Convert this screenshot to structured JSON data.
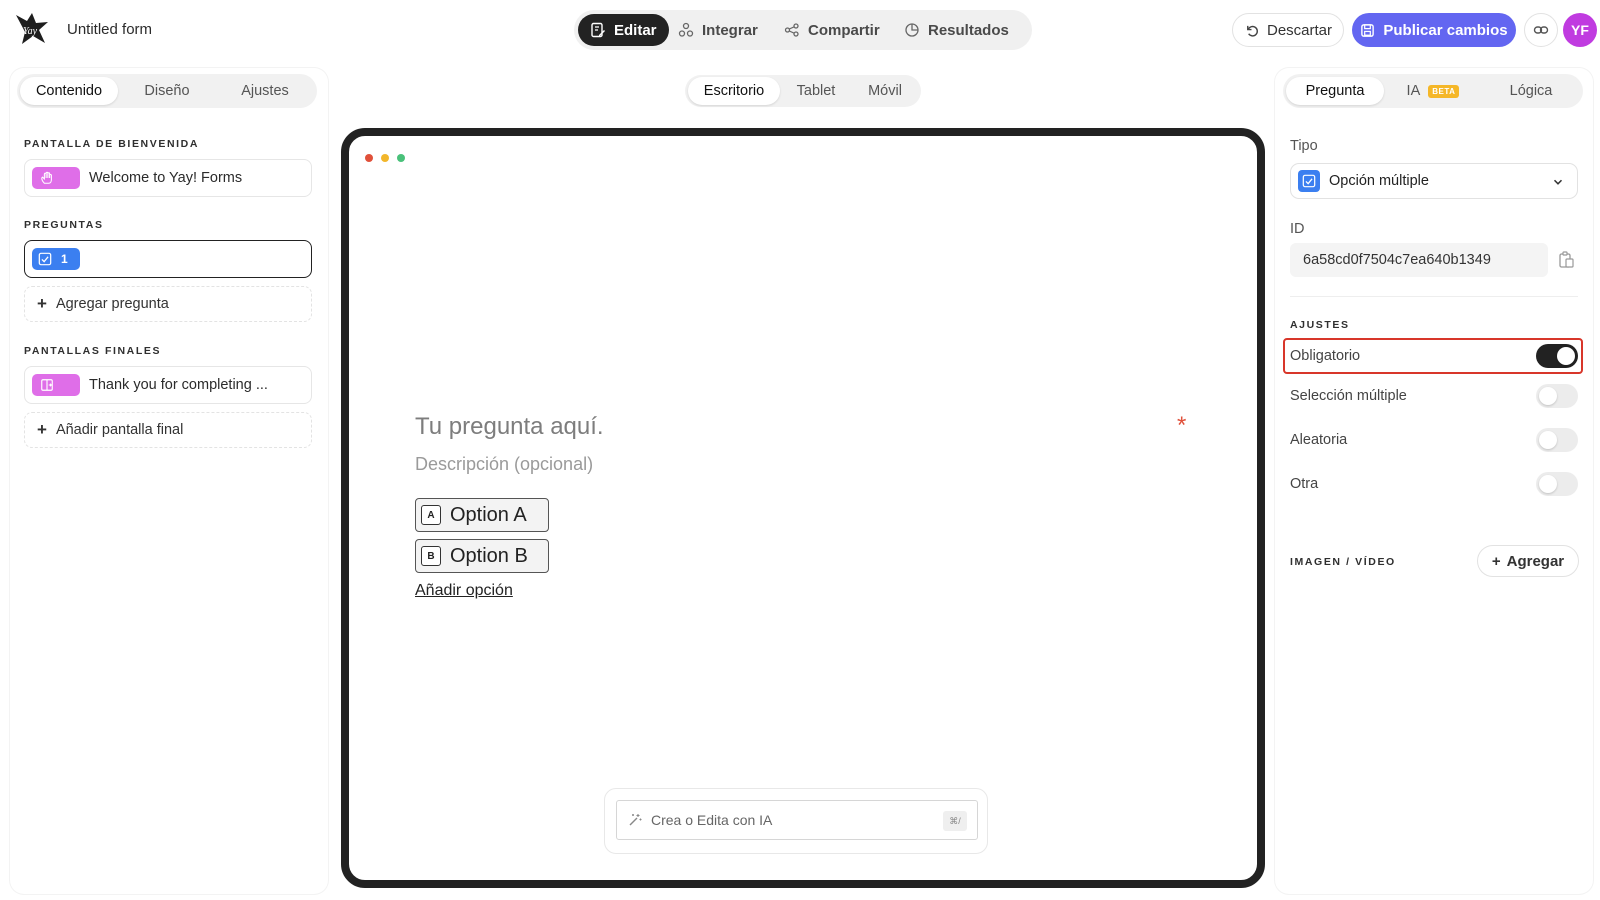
{
  "header": {
    "form_title": "Untitled form",
    "modes": [
      {
        "label": "Editar",
        "icon": "edit-icon",
        "active": true
      },
      {
        "label": "Integrar",
        "icon": "integrate-icon",
        "active": false
      },
      {
        "label": "Compartir",
        "icon": "share-icon",
        "active": false
      },
      {
        "label": "Resultados",
        "icon": "results-icon",
        "active": false
      }
    ],
    "discard_label": "Descartar",
    "publish_label": "Publicar cambios",
    "avatar_initials": "YF",
    "accent_color": "#6366f1",
    "avatar_color": "#c03be0"
  },
  "left": {
    "tabs": [
      "Contenido",
      "Diseño",
      "Ajustes"
    ],
    "active_tab": "Contenido",
    "welcome_label": "PANTALLA DE BIENVENIDA",
    "welcome_item": "Welcome to Yay! Forms",
    "questions_label": "PREGUNTAS",
    "question_number": "1",
    "add_question": "Agregar pregunta",
    "endings_label": "PANTALLAS FINALES",
    "ending_item": "Thank you for completing ...",
    "add_ending": "Añadir pantalla final"
  },
  "center": {
    "devices": [
      "Escritorio",
      "Tablet",
      "Móvil"
    ],
    "active_device": "Escritorio",
    "question_title": "Tu pregunta aquí.",
    "required_mark": "*",
    "question_desc": "Descripción (opcional)",
    "options": [
      {
        "key": "A",
        "label": "Option A"
      },
      {
        "key": "B",
        "label": "Option B"
      }
    ],
    "add_option": "Añadir opción",
    "ai_placeholder": "Crea o Edita con IA",
    "ai_shortcut": "⌘/"
  },
  "right": {
    "tabs": [
      "Pregunta",
      "IA",
      "Lógica"
    ],
    "beta_badge": "BETA",
    "active_tab": "Pregunta",
    "type_label": "Tipo",
    "type_value": "Opción múltiple",
    "id_label": "ID",
    "id_value": "6a58cd0f7504c7ea640b1349",
    "settings_label": "AJUSTES",
    "settings": [
      {
        "label": "Obligatorio",
        "on": true
      },
      {
        "label": "Selección múltiple",
        "on": false
      },
      {
        "label": "Aleatoria",
        "on": false
      },
      {
        "label": "Otra",
        "on": false
      }
    ],
    "media_label": "IMAGEN / VÍDEO",
    "add_media": "Agregar"
  }
}
